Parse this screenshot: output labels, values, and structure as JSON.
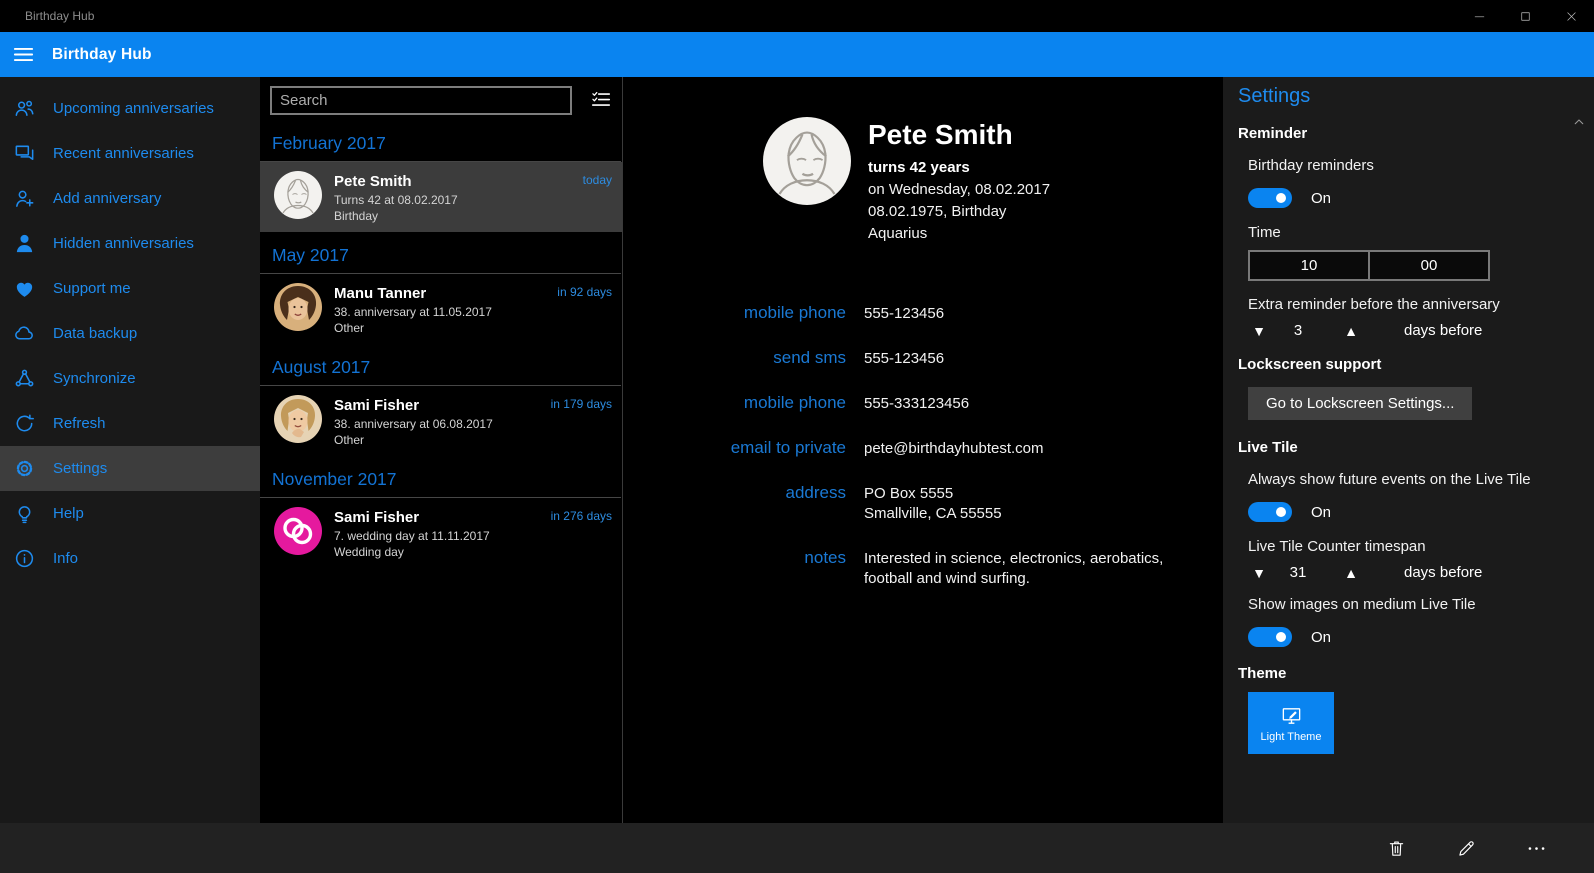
{
  "window": {
    "title": "Birthday Hub"
  },
  "header": {
    "app_title": "Birthday Hub"
  },
  "colors": {
    "accent": "#0a84f0",
    "link_blue": "#1e8bee",
    "month_header_blue": "#1373d4",
    "due_blue": "#2d8ce0",
    "sidebar_bg": "#191919",
    "settings_panel_bg": "#1b1b1b",
    "commandbar_bg": "#222222",
    "selected_bg": "#3c3c3c",
    "rings_avatar_pink": "#e5199e"
  },
  "sidebar": {
    "items": [
      {
        "id": "upcoming-anniversaries",
        "icon": "people",
        "label": "Upcoming anniversaries",
        "selected": false
      },
      {
        "id": "recent-anniversaries",
        "icon": "chat",
        "label": "Recent anniversaries",
        "selected": false
      },
      {
        "id": "add-anniversary",
        "icon": "person-add",
        "label": "Add anniversary",
        "selected": false
      },
      {
        "id": "hidden-anniversaries",
        "icon": "person",
        "label": "Hidden anniversaries",
        "selected": false
      },
      {
        "id": "support-me",
        "icon": "heart",
        "label": "Support me",
        "selected": false
      },
      {
        "id": "data-backup",
        "icon": "cloud",
        "label": "Data backup",
        "selected": false
      },
      {
        "id": "synchronize",
        "icon": "sync",
        "label": "Synchronize",
        "selected": false
      },
      {
        "id": "refresh",
        "icon": "refresh",
        "label": "Refresh",
        "selected": false
      },
      {
        "id": "settings",
        "icon": "gear",
        "label": "Settings",
        "selected": true
      },
      {
        "id": "help",
        "icon": "bulb",
        "label": "Help",
        "selected": false
      },
      {
        "id": "info",
        "icon": "info",
        "label": "Info",
        "selected": false
      }
    ]
  },
  "list": {
    "search_placeholder": "Search",
    "groups": [
      {
        "month": "February 2017",
        "items": [
          {
            "avatar": "pete",
            "name": "Pete Smith",
            "line1": "Turns 42 at 08.02.2017",
            "line2": "Birthday",
            "due": "today",
            "selected": true
          }
        ]
      },
      {
        "month": "May 2017",
        "items": [
          {
            "avatar": "manu",
            "name": "Manu Tanner",
            "line1": "38. anniversary at 11.05.2017",
            "line2": "Other",
            "due": "in 92 days",
            "selected": false
          }
        ]
      },
      {
        "month": "August 2017",
        "items": [
          {
            "avatar": "sami",
            "name": "Sami Fisher",
            "line1": "38. anniversary at 06.08.2017",
            "line2": "Other",
            "due": "in 179 days",
            "selected": false
          }
        ]
      },
      {
        "month": "November 2017",
        "items": [
          {
            "avatar": "rings",
            "name": "Sami Fisher",
            "line1": "7. wedding day at 11.11.2017",
            "line2": "Wedding day",
            "due": "in 276 days",
            "selected": false
          }
        ]
      }
    ]
  },
  "detail": {
    "name": "Pete Smith",
    "age_line": "turns 42 years",
    "date_line": "on Wednesday, 08.02.2017",
    "birth_line": "08.02.1975, Birthday",
    "zodiac": "Aquarius",
    "fields": [
      {
        "label": "mobile phone",
        "value": [
          "555-123456"
        ]
      },
      {
        "label": "send sms",
        "value": [
          "555-123456"
        ]
      },
      {
        "label": "mobile phone",
        "value": [
          "555-333123456"
        ]
      },
      {
        "label": "email to private",
        "value": [
          "pete@birthdayhubtest.com"
        ]
      },
      {
        "label": "address",
        "value": [
          "PO Box 5555",
          "Smallville, CA 55555"
        ]
      },
      {
        "label": "notes",
        "value": [
          "Interested in science, electronics, aerobatics,",
          "football and wind surfing."
        ]
      }
    ]
  },
  "settings": {
    "title": "Settings",
    "reminder": {
      "header": "Reminder",
      "birthday_reminders_label": "Birthday reminders",
      "birthday_reminders_state": "On",
      "time_label": "Time",
      "time_hour": "10",
      "time_minute": "00",
      "extra_label": "Extra reminder before the anniversary",
      "extra_value": "3",
      "extra_unit": "days before"
    },
    "lockscreen": {
      "header": "Lockscreen support",
      "button_label": "Go to Lockscreen Settings..."
    },
    "live_tile": {
      "header": "Live Tile",
      "future_label": "Always show future events on the Live Tile",
      "future_state": "On",
      "counter_label": "Live Tile Counter timespan",
      "counter_value": "31",
      "counter_unit": "days before",
      "images_label": "Show images on medium Live Tile",
      "images_state": "On"
    },
    "theme": {
      "header": "Theme",
      "light_label": "Light Theme"
    }
  },
  "commandbar": {
    "buttons": [
      {
        "id": "delete",
        "icon": "trash-icon"
      },
      {
        "id": "edit",
        "icon": "pencil-icon"
      },
      {
        "id": "more",
        "icon": "ellipsis-icon"
      }
    ]
  }
}
